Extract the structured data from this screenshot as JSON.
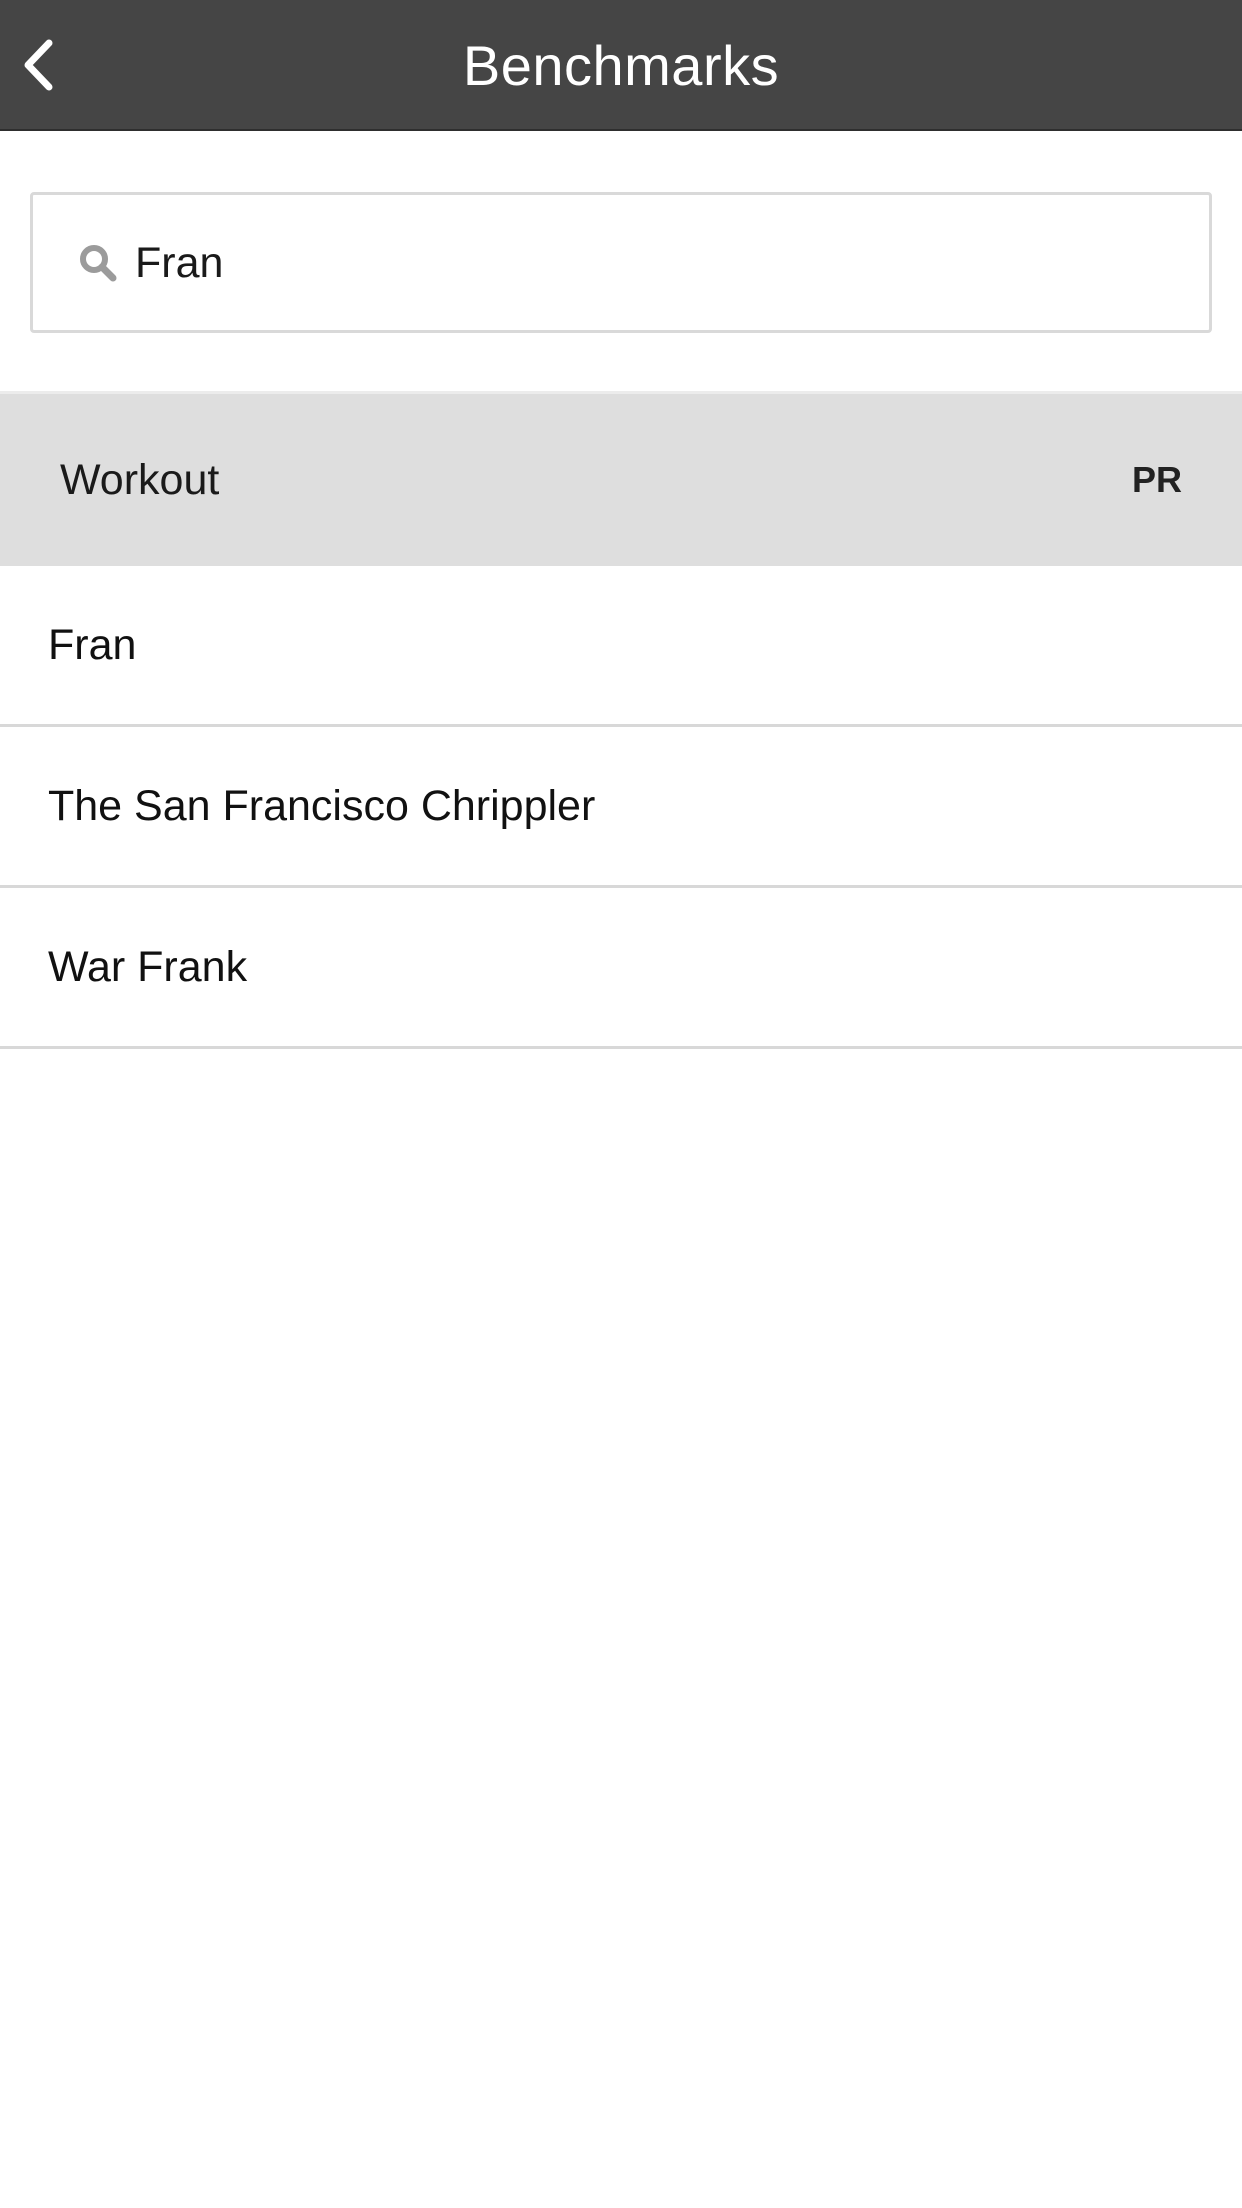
{
  "header": {
    "title": "Benchmarks",
    "back_icon": "chevron-left-icon",
    "background": "#454545"
  },
  "search": {
    "value": "Fran",
    "icon": "search-icon"
  },
  "list_header": {
    "workout_label": "Workout",
    "pr_label": "PR"
  },
  "results": [
    {
      "name": "Fran"
    },
    {
      "name": "The San Francisco Chrippler"
    },
    {
      "name": "War Frank"
    }
  ]
}
